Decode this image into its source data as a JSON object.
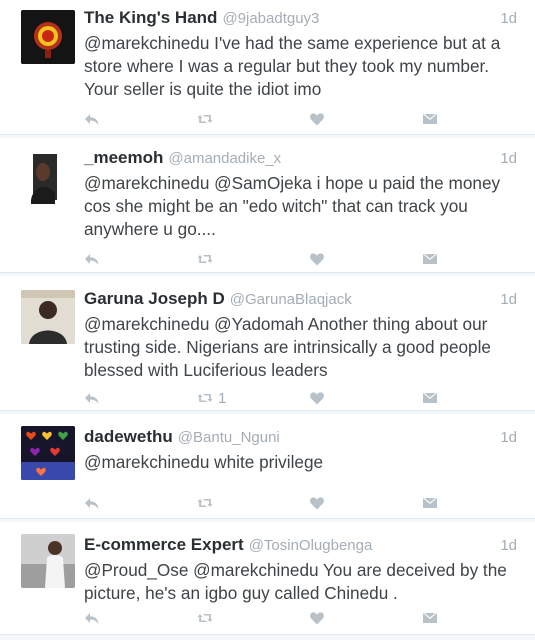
{
  "tweets": [
    {
      "name": "The King's Hand",
      "handle": "@9jabadtguy3",
      "time": "1d",
      "text": "@marekchinedu I've had the same experience but at a store where I was a regular but they took my number. Your seller is quite the idiot imo",
      "retweet_count": "",
      "avatar": "crest-avatar"
    },
    {
      "name": "_meemoh",
      "handle": "@amandadike_x",
      "time": "1d",
      "text": "@marekchinedu @SamOjeka i hope u paid the money cos she might be an \"edo witch\" that can track you anywhere u go....",
      "retweet_count": "",
      "avatar": "portrait-avatar"
    },
    {
      "name": "Garuna Joseph D",
      "handle": "@GarunaBlaqjack",
      "time": "1d",
      "text": "@marekchinedu @Yadomah Another thing about our trusting side. Nigerians are intrinsically a good people blessed with Luciferious leaders",
      "retweet_count": "1",
      "avatar": "photo-avatar"
    },
    {
      "name": "dadewethu",
      "handle": "@Bantu_Nguni",
      "time": "1d",
      "text": "@marekchinedu white privilege",
      "retweet_count": "",
      "avatar": "hearts-avatar"
    },
    {
      "name": "E-commerce Expert",
      "handle": "@TosinOlugbenga",
      "time": "1d",
      "text": "@Proud_Ose @marekchinedu You are deceived by the picture, he's an igbo guy called Chinedu  .",
      "retweet_count": "",
      "avatar": "person-avatar"
    }
  ],
  "icons": {
    "reply": "reply-icon",
    "retweet": "retweet-icon",
    "like": "heart-icon",
    "message": "message-icon"
  },
  "colors": {
    "name": "#292f33",
    "handle": "#a4adb5",
    "text": "#3f4448",
    "icon": "#b8c1c8",
    "divider": "#e1e8ed"
  }
}
